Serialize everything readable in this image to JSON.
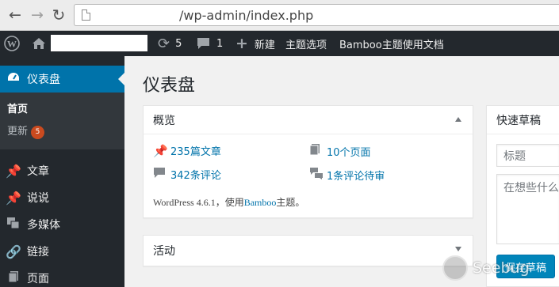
{
  "browser": {
    "back_icon": "arrow-left-icon",
    "forward_icon": "arrow-right-icon",
    "reload_icon": "reload-icon",
    "url": "/wp-admin/index.php"
  },
  "adminbar": {
    "updates_count": "5",
    "comments_count": "1",
    "new_label": "新建",
    "theme_options_label": "主题选项",
    "docs_label": "Bamboo主题使用文档"
  },
  "sidebar": {
    "dashboard_label": "仪表盘",
    "submenu": {
      "home_label": "首页",
      "updates_label": "更新",
      "updates_badge": "5"
    },
    "items": [
      {
        "label": "文章",
        "icon": "pin-icon"
      },
      {
        "label": "说说",
        "icon": "pin-icon"
      },
      {
        "label": "多媒体",
        "icon": "media-icon"
      },
      {
        "label": "链接",
        "icon": "link-icon"
      },
      {
        "label": "页面",
        "icon": "page-icon"
      }
    ]
  },
  "main": {
    "title": "仪表盘",
    "glance": {
      "title": "概览",
      "posts": "235篇文章",
      "pages": "10个页面",
      "comments": "342条评论",
      "pending": "1条评论待审",
      "version_text": "WordPress 4.6.1，使用",
      "theme_name": "Bamboo",
      "theme_suffix": "主题。"
    },
    "activity": {
      "title": "活动"
    },
    "quick_draft": {
      "title": "快速草稿",
      "title_placeholder": "标题",
      "content_placeholder": "在想些什么",
      "save_label": "保存草稿"
    }
  },
  "watermark": {
    "text": "Seebug"
  },
  "colors": {
    "admin_dark": "#23282d",
    "accent_blue": "#0073aa",
    "badge_orange": "#ca4a1f"
  }
}
